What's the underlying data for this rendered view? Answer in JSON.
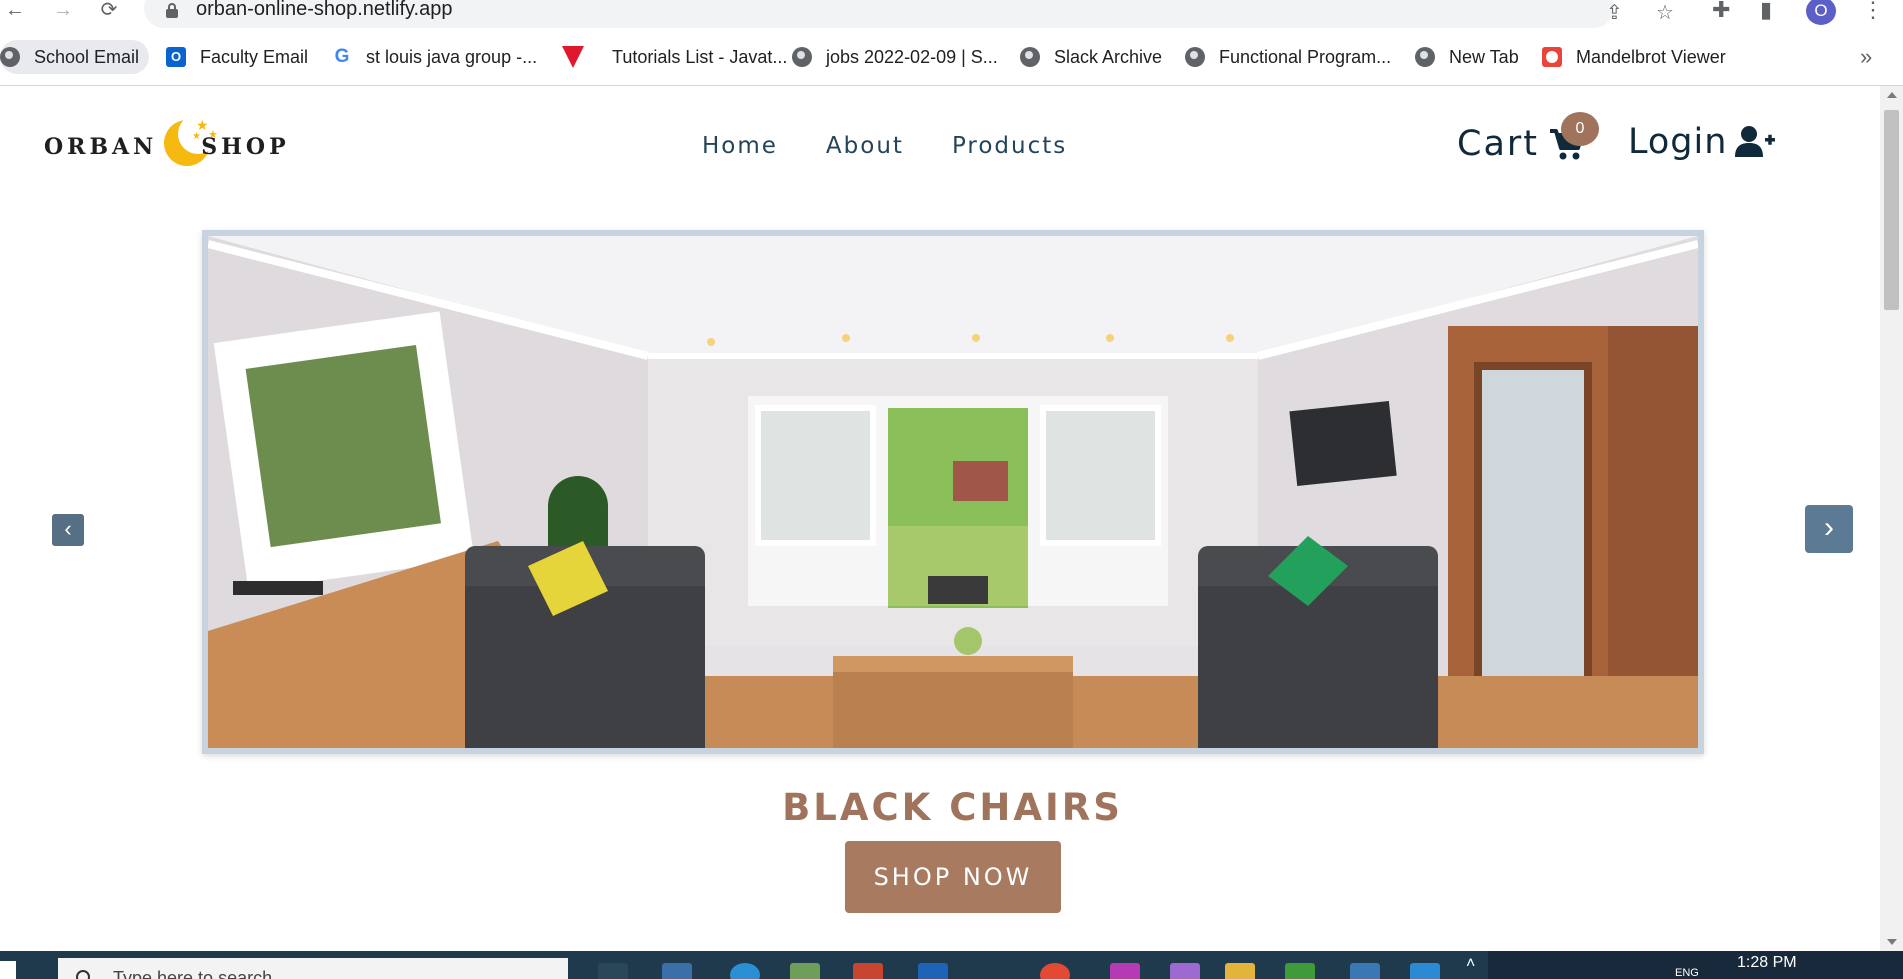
{
  "browser": {
    "url": "orban-online-shop.netlify.app",
    "bookmarks": [
      {
        "label": "School Email",
        "icon": "globe-icon"
      },
      {
        "label": "Faculty Email",
        "icon": "outlook-icon"
      },
      {
        "label": "st louis java group -...",
        "icon": "google-icon"
      },
      {
        "label": "Tutorials List - Javat...",
        "icon": "javatpoint-icon"
      },
      {
        "label": "jobs 2022-02-09 | S...",
        "icon": "globe-icon"
      },
      {
        "label": "Slack Archive",
        "icon": "globe-icon"
      },
      {
        "label": "Functional Program...",
        "icon": "globe-icon"
      },
      {
        "label": "New Tab",
        "icon": "globe-icon"
      },
      {
        "label": "Mandelbrot Viewer",
        "icon": "mandelbrot-icon"
      }
    ],
    "profile_initial": "O",
    "more_bookmarks": "»"
  },
  "site": {
    "logo_left": "ORBAN",
    "logo_right": "SHOP",
    "nav": [
      "Home",
      "About",
      "Products"
    ],
    "cart_label": "Cart",
    "cart_count": "0",
    "login_label": "Login"
  },
  "hero": {
    "title": "BLACK CHAIRS",
    "button": "SHOP NOW",
    "prev": "‹",
    "next": "›"
  },
  "taskbar": {
    "search_placeholder": "Type here to search",
    "time": "1:28 PM",
    "language": "ENG"
  },
  "colors": {
    "accent_brown": "#a0735c",
    "nav_text": "#244559",
    "carousel_button": "#5c7a93"
  }
}
